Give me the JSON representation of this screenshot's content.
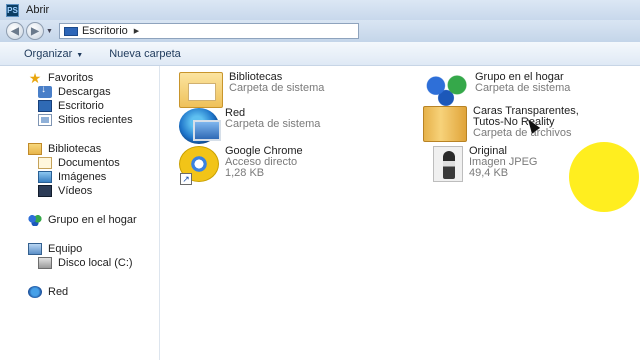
{
  "window": {
    "title": "Abrir",
    "app_icon": "PS"
  },
  "address": {
    "location": "Escritorio"
  },
  "toolbar": {
    "organize_label": "Organizar",
    "new_folder_label": "Nueva carpeta"
  },
  "sidebar": {
    "favorites": "Favoritos",
    "downloads": "Descargas",
    "desktop": "Escritorio",
    "recent": "Sitios recientes",
    "libraries": "Bibliotecas",
    "documents": "Documentos",
    "images": "Imágenes",
    "videos": "Vídeos",
    "homegroup": "Grupo en el hogar",
    "computer": "Equipo",
    "local_disk": "Disco local (C:)",
    "network": "Red"
  },
  "items": [
    {
      "name": "Bibliotecas",
      "type": "Carpeta de sistema",
      "icon": "library-icon"
    },
    {
      "name": "Grupo en el hogar",
      "type": "Carpeta de sistema",
      "icon": "homegroup-icon"
    },
    {
      "name": "Red",
      "type": "Carpeta de sistema",
      "icon": "network-icon"
    },
    {
      "name": "Caras Transparentes, Tutos-No Reality",
      "name_line1": "Caras Transparentes,",
      "name_line2": "Tutos-No Reality",
      "type": "Carpeta de archivos",
      "icon": "folder-icon"
    },
    {
      "name": "Google Chrome",
      "type": "Acceso directo",
      "size": "1,28 KB",
      "icon": "chrome-icon"
    },
    {
      "name": "Original",
      "type": "Imagen JPEG",
      "size": "49,4 KB",
      "icon": "photo-icon"
    }
  ],
  "colors": {
    "highlight": "#ffec00",
    "toolbar_text": "#1e395b",
    "secondary_text": "#7a7a7a"
  }
}
